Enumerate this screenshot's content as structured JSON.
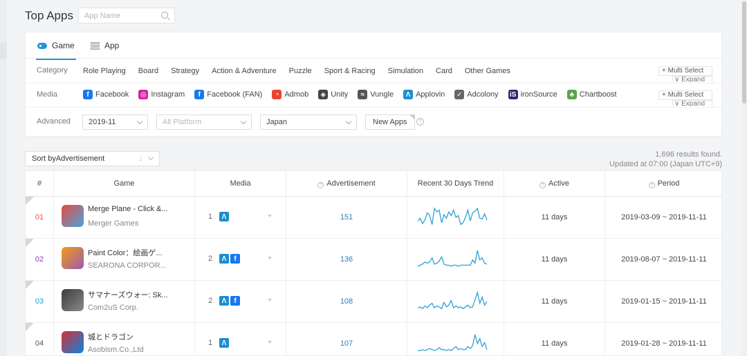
{
  "header": {
    "title": "Top Apps",
    "search_placeholder": "App Name"
  },
  "tabs": [
    {
      "label": "Game",
      "active": true
    },
    {
      "label": "App",
      "active": false
    }
  ],
  "filters": {
    "category_label": "Category",
    "categories": [
      "Role Playing",
      "Board",
      "Strategy",
      "Action & Adventure",
      "Puzzle",
      "Sport & Racing",
      "Simulation",
      "Card",
      "Other Games"
    ],
    "media_label": "Media",
    "media": [
      {
        "label": "Facebook",
        "icon": "facebook-icon",
        "color": "#1877f2",
        "glyph": "f"
      },
      {
        "label": "Instagram",
        "icon": "instagram-icon",
        "color": "#d6249f",
        "glyph": "◎"
      },
      {
        "label": "Facebook (FAN)",
        "icon": "facebook-fan-icon",
        "color": "#1877f2",
        "glyph": "f"
      },
      {
        "label": "Admob",
        "icon": "admob-icon",
        "color": "#ea4335",
        "glyph": "◔"
      },
      {
        "label": "Unity",
        "icon": "unity-icon",
        "color": "#444444",
        "glyph": "◈"
      },
      {
        "label": "Vungle",
        "icon": "vungle-icon",
        "color": "#555555",
        "glyph": "≈"
      },
      {
        "label": "Applovin",
        "icon": "applovin-icon",
        "color": "#1a8fcf",
        "glyph": "Λ"
      },
      {
        "label": "Adcolony",
        "icon": "adcolony-icon",
        "color": "#666666",
        "glyph": "✓"
      },
      {
        "label": "ironSource",
        "icon": "ironsource-icon",
        "color": "#2b2d6e",
        "glyph": "iS"
      },
      {
        "label": "Chartboost",
        "icon": "chartboost-icon",
        "color": "#5aa54a",
        "glyph": "♣"
      }
    ],
    "multi_select": "+ Multi Select",
    "expand": "∨ Expand",
    "advanced_label": "Advanced",
    "month": "2019-11",
    "platform_placeholder": "All Platform",
    "country": "Japan",
    "new_apps": "New Apps"
  },
  "sort": {
    "label": "Sort byAdvertisement",
    "arrow": "↓"
  },
  "results": {
    "count_text": "1,696 results found.",
    "updated_text": "Updated at 07:00 (Japan UTC+9)"
  },
  "table": {
    "columns": {
      "rank": "#",
      "game": "Game",
      "media": "Media",
      "advertisement": "Advertisement",
      "trend": "Recent 30 Days Trend",
      "active": "Active",
      "period": "Period"
    },
    "rows": [
      {
        "rank": "01",
        "rank_color": "#e0533c",
        "name": "Merge Plane - Click &...",
        "developer": "Merger Games",
        "media_count": "1",
        "media_icons": [
          "applovin"
        ],
        "ads": "151",
        "active": "11 days",
        "period": "2019-03-09 ~ 2019-11-11",
        "icon_colors": [
          "#e94b3c",
          "#4aa3df"
        ],
        "trend": [
          6,
          9,
          3,
          7,
          15,
          12,
          2,
          20,
          16,
          18,
          4,
          13,
          9,
          16,
          12,
          18,
          10,
          12,
          2,
          4,
          10,
          18,
          6,
          15,
          17,
          20,
          9,
          8,
          14,
          7
        ]
      },
      {
        "rank": "02",
        "rank_color": "#8e44ad",
        "name": "Paint Color：絵画ゲ...",
        "developer": "SEARONA CORPOR...",
        "media_count": "2",
        "media_icons": [
          "applovin",
          "facebook"
        ],
        "ads": "136",
        "active": "11 days",
        "period": "2019-08-07 ~ 2019-11-11",
        "icon_colors": [
          "#f39c12",
          "#9b59b6"
        ],
        "trend": [
          2,
          3,
          4,
          6,
          5,
          6,
          10,
          4,
          5,
          7,
          11,
          4,
          3,
          3,
          2,
          3,
          3,
          2,
          3,
          3,
          3,
          3,
          3,
          8,
          5,
          17,
          8,
          10,
          5,
          4
        ]
      },
      {
        "rank": "03",
        "rank_color": "#1f9ad6",
        "name": "サマナーズウォー: Sk...",
        "developer": "Com2uS Corp.",
        "media_count": "2",
        "media_icons": [
          "applovin",
          "facebook"
        ],
        "ads": "108",
        "active": "11 days",
        "period": "2019-01-15 ~ 2019-11-11",
        "icon_colors": [
          "#3b3b3b",
          "#8a8a8a"
        ],
        "trend": [
          3,
          4,
          2,
          5,
          3,
          6,
          8,
          3,
          5,
          4,
          2,
          9,
          4,
          6,
          11,
          3,
          5,
          3,
          4,
          2,
          4,
          6,
          3,
          4,
          12,
          20,
          8,
          15,
          6,
          10
        ]
      },
      {
        "rank": "04",
        "rank_color": "#555555",
        "name": "城とドラゴン",
        "developer": "Asobism.Co.,Ltd",
        "media_count": "1",
        "media_icons": [
          "applovin"
        ],
        "ads": "107",
        "active": "11 days",
        "period": "2019-01-28 ~ 2019-11-11",
        "icon_colors": [
          "#d63031",
          "#0984e3"
        ],
        "trend": [
          2,
          2,
          3,
          2,
          3,
          4,
          3,
          2,
          3,
          5,
          3,
          3,
          2,
          3,
          2,
          4,
          6,
          3,
          4,
          3,
          3,
          6,
          4,
          7,
          18,
          9,
          14,
          6,
          10,
          3
        ]
      }
    ]
  }
}
